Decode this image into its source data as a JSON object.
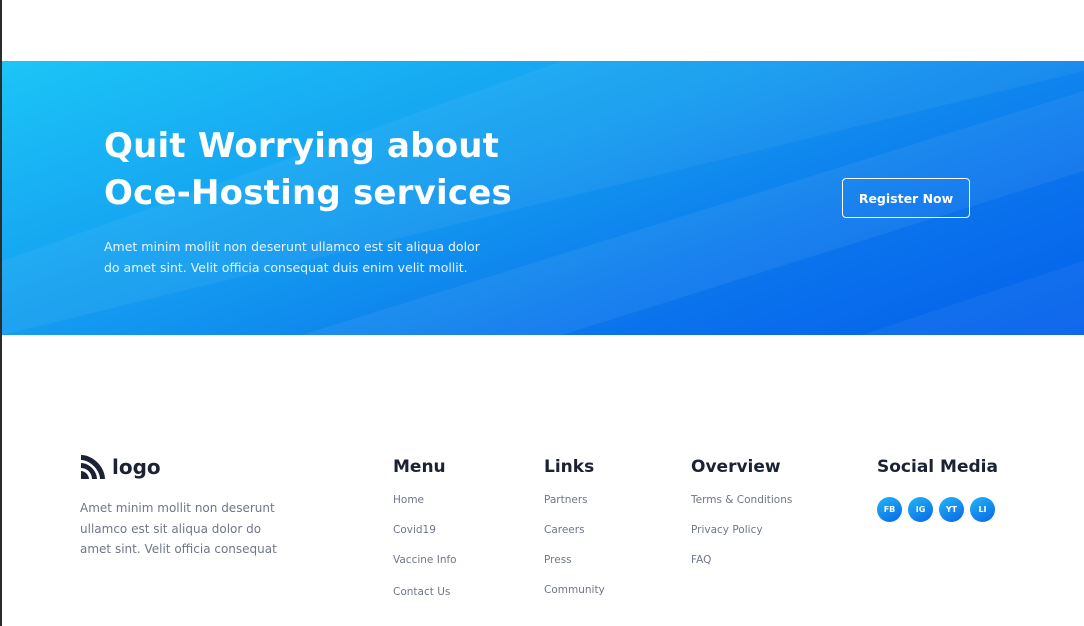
{
  "cta": {
    "title_line1": "Quit Worrying about",
    "title_line2": "Oce-Hosting services",
    "description": "Amet minim mollit non deserunt ullamco est sit aliqua dolor do amet sint. Velit officia consequat duis enim velit mollit.",
    "button_label": "Register Now",
    "gradient_start": "#1cc5f7",
    "gradient_end": "#0360ea"
  },
  "footer": {
    "brand": {
      "logo_icon": "rss-like-logo-icon",
      "name": "logo"
    },
    "description": "Amet minim mollit non deserunt ullamco est sit aliqua dolor do amet sint. Velit officia consequat",
    "menu": {
      "title": "Menu",
      "items": [
        "Home",
        "Covid19",
        "Vaccine Info",
        "Contact Us"
      ]
    },
    "links": {
      "title": "Links",
      "items": [
        "Partners",
        "Careers",
        "Press",
        "Community"
      ]
    },
    "overview": {
      "title": "Overview",
      "items": [
        "Terms & Conditions",
        "Privacy Policy",
        "FAQ"
      ]
    },
    "social": {
      "title": "Social Media",
      "items": [
        "FB",
        "IG",
        "YT",
        "LI"
      ]
    },
    "text_color": "#6f7787",
    "heading_color": "#1a2233"
  }
}
